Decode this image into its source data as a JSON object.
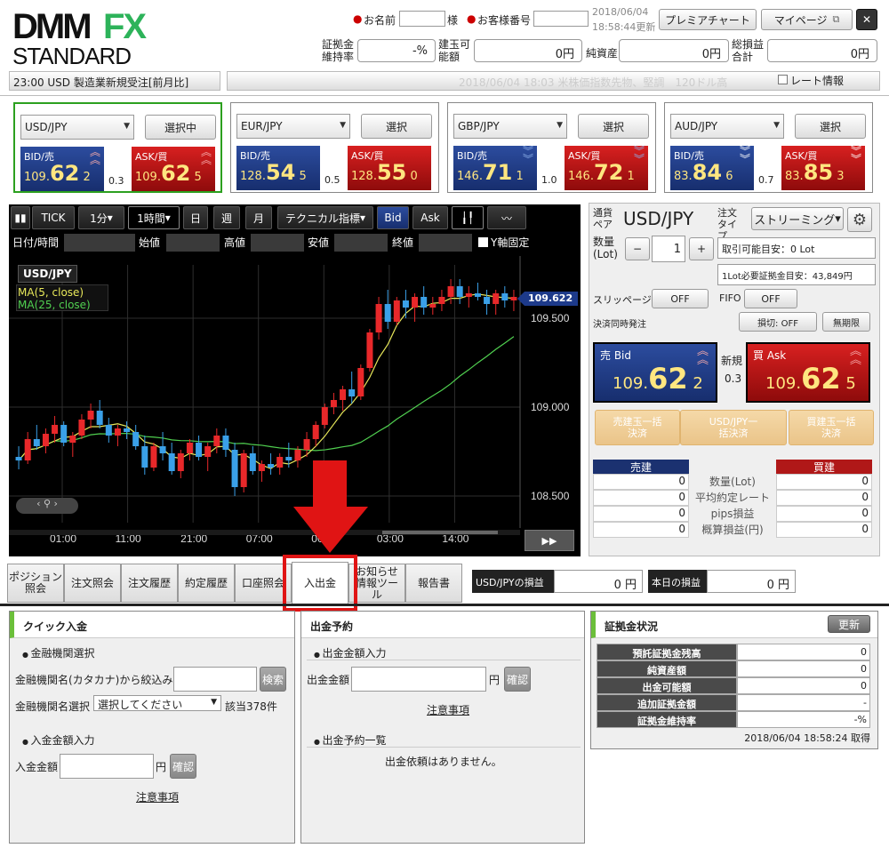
{
  "header": {
    "logo_main": "DMM",
    "logo_fx": "FX",
    "logo_sub": "STANDARD",
    "name_label": "お名前",
    "name_suffix": "様",
    "customer_no_label": "お客様番号",
    "datetime_date": "2018/06/04",
    "datetime_time": "18:58:44更新",
    "premier_chart": "プレミアチャート",
    "my_page": "マイページ",
    "close": "✕",
    "margin_ratio_label": "証拠金維持率",
    "margin_ratio": "-%",
    "position_capacity_label": "建玉可能額",
    "position_capacity": "0円",
    "net_assets_label": "純資産",
    "net_assets": "0円",
    "total_pl_label": "総損益合計",
    "total_pl": "0円"
  },
  "news": {
    "left": "23:00 USD 製造業新規受注[前月比]",
    "right": "2018/06/04 18:03 米株価指数先物、堅調　120ドル高",
    "rate_info": "レート情報"
  },
  "currencies": [
    {
      "pair": "USD/JPY",
      "btn": "選択中",
      "bid_label": "BID/売",
      "ask_label": "ASK/買",
      "bid_pre": "109.",
      "bid_big": "62",
      "bid_small": "2",
      "ask_pre": "109.",
      "ask_big": "62",
      "ask_small": "5",
      "spread": "0.3",
      "dir": "up"
    },
    {
      "pair": "EUR/JPY",
      "btn": "選択",
      "bid_label": "BID/売",
      "ask_label": "ASK/買",
      "bid_pre": "128.",
      "bid_big": "54",
      "bid_small": "5",
      "ask_pre": "128.",
      "ask_big": "55",
      "ask_small": "0",
      "spread": "0.5",
      "dir": "none"
    },
    {
      "pair": "GBP/JPY",
      "btn": "選択",
      "bid_label": "BID/売",
      "ask_label": "ASK/買",
      "bid_pre": "146.",
      "bid_big": "71",
      "bid_small": "1",
      "ask_pre": "146.",
      "ask_big": "72",
      "ask_small": "1",
      "spread": "1.0",
      "dir": "down"
    },
    {
      "pair": "AUD/JPY",
      "btn": "選択",
      "bid_label": "BID/売",
      "ask_label": "ASK/買",
      "bid_pre": "83.",
      "bid_big": "84",
      "bid_small": "6",
      "ask_pre": "83.",
      "ask_big": "85",
      "ask_small": "3",
      "spread": "0.7",
      "dir": "down"
    }
  ],
  "chart": {
    "tick": "TICK",
    "interval": "1分",
    "timeframe": "1時間",
    "day": "日",
    "week": "週",
    "month": "月",
    "indicator": "テクニカル指標",
    "bid": "Bid",
    "ask": "Ask",
    "date_label": "日付/時間",
    "open_label": "始値",
    "high_label": "高値",
    "low_label": "安値",
    "close_label": "終値",
    "yfix": "Y軸固定",
    "symbol": "USD/JPY",
    "ma5": "MA(5, close)",
    "ma25": "MA(25, close)",
    "current_price": "109.622",
    "yticks": [
      "109.500",
      "109.000",
      "108.500"
    ],
    "xticks": [
      "01:00",
      "11:00",
      "21:00",
      "07:00",
      "00",
      "03:00",
      "14:00"
    ],
    "fwd": "▶▶"
  },
  "order": {
    "pair_label": "通貨ペア",
    "pair": "USD/JPY",
    "type_label": "注文タイプ",
    "type": "ストリーミング",
    "qty_label": "数量(Lot)",
    "qty": "1",
    "minus": "−",
    "plus": "+",
    "tradable": "取引可能目安：0 Lot",
    "required_margin": "1Lot必要証拠金目安：43,849円",
    "slippage_label": "スリッページ",
    "slippage": "OFF",
    "fifo_label": "FIFO",
    "fifo": "OFF",
    "settle_label": "決済同時発注",
    "stoploss": "損切: OFF",
    "unlimited": "無期限",
    "sell_label": "売 Bid",
    "sell_pre": "109.",
    "sell_big": "62",
    "sell_small": "2",
    "buy_label": "買 Ask",
    "buy_pre": "109.",
    "buy_big": "62",
    "buy_small": "5",
    "new_label": "新規",
    "spread": "0.3",
    "bulk_sell": "売建玉一括決済",
    "bulk_pair": "USD/JPY一括決済",
    "bulk_buy": "買建玉一括決済",
    "sell_head": "売建",
    "buy_head": "買建",
    "rows": [
      {
        "label": "数量(Lot)",
        "sell": "0",
        "buy": "0"
      },
      {
        "label": "平均約定レート",
        "sell": "0",
        "buy": "0"
      },
      {
        "label": "pips損益",
        "sell": "0",
        "buy": "0"
      },
      {
        "label": "概算損益(円)",
        "sell": "0",
        "buy": "0"
      }
    ]
  },
  "tabs": [
    "ポジション照会",
    "注文照会",
    "注文履歴",
    "約定履歴",
    "口座照会",
    "入出金",
    "お知らせ情報ツール",
    "報告書"
  ],
  "pl": {
    "pair_label": "USD/JPYの損益",
    "pair_value": "0 円",
    "today_label": "本日の損益",
    "today_value": "0 円"
  },
  "quick": {
    "title": "クイック入金",
    "bank_sec": "金融機関選択",
    "kana_label": "金融機関名(カタカナ)から絞込み",
    "search": "検索",
    "bank_label": "金融機関名選択",
    "bank_select": "選択してください",
    "count": "該当378件",
    "amount_sec": "入金金額入力",
    "amount_label": "入金金額",
    "yen": "円",
    "confirm": "確認",
    "notice": "注意事項"
  },
  "withdraw": {
    "title": "出金予約",
    "amount_sec": "出金金額入力",
    "amount_label": "出金金額",
    "yen": "円",
    "confirm": "確認",
    "notice": "注意事項",
    "list_sec": "出金予約一覧",
    "empty": "出金依頼はありません。"
  },
  "margin": {
    "title": "証拠金状況",
    "refresh": "更新",
    "rows": [
      {
        "label": "預託証拠金残高",
        "value": "0"
      },
      {
        "label": "純資産額",
        "value": "0"
      },
      {
        "label": "出金可能額",
        "value": "0"
      },
      {
        "label": "追加証拠金額",
        "value": "-"
      },
      {
        "label": "証拠金維持率",
        "value": "-%"
      }
    ],
    "timestamp": "2018/06/04 18:58:24 取得"
  },
  "candles": [
    [
      108.72,
      108.78,
      108.65,
      108.7
    ],
    [
      108.7,
      108.86,
      108.68,
      108.82
    ],
    [
      108.82,
      108.9,
      108.76,
      108.78
    ],
    [
      108.78,
      108.88,
      108.74,
      108.85
    ],
    [
      108.85,
      108.95,
      108.8,
      108.9
    ],
    [
      108.9,
      108.92,
      108.78,
      108.8
    ],
    [
      108.8,
      108.86,
      108.72,
      108.84
    ],
    [
      108.84,
      108.96,
      108.82,
      108.93
    ],
    [
      108.93,
      109.02,
      108.88,
      108.98
    ],
    [
      108.98,
      109.04,
      108.88,
      108.9
    ],
    [
      108.9,
      108.94,
      108.8,
      108.84
    ],
    [
      108.84,
      108.9,
      108.78,
      108.88
    ],
    [
      108.88,
      108.92,
      108.82,
      108.86
    ],
    [
      108.86,
      108.9,
      108.76,
      108.78
    ],
    [
      108.78,
      108.84,
      108.62,
      108.66
    ],
    [
      108.66,
      108.8,
      108.64,
      108.78
    ],
    [
      108.78,
      108.86,
      108.7,
      108.74
    ],
    [
      108.74,
      108.8,
      108.62,
      108.64
    ],
    [
      108.64,
      108.76,
      108.6,
      108.74
    ],
    [
      108.74,
      108.82,
      108.7,
      108.8
    ],
    [
      108.8,
      108.84,
      108.7,
      108.72
    ],
    [
      108.72,
      108.8,
      108.64,
      108.78
    ],
    [
      108.78,
      108.88,
      108.74,
      108.84
    ],
    [
      108.84,
      108.88,
      108.72,
      108.76
    ],
    [
      108.76,
      108.8,
      108.5,
      108.55
    ],
    [
      108.55,
      108.76,
      108.52,
      108.74
    ],
    [
      108.74,
      108.78,
      108.62,
      108.64
    ],
    [
      108.64,
      108.7,
      108.58,
      108.68
    ],
    [
      108.68,
      108.74,
      108.62,
      108.66
    ],
    [
      108.66,
      108.74,
      108.62,
      108.72
    ],
    [
      108.72,
      108.8,
      108.66,
      108.7
    ],
    [
      108.7,
      108.78,
      108.66,
      108.76
    ],
    [
      108.76,
      108.86,
      108.72,
      108.82
    ],
    [
      108.82,
      108.92,
      108.78,
      108.9
    ],
    [
      108.9,
      109.02,
      108.88,
      109.0
    ],
    [
      109.0,
      109.08,
      108.96,
      109.04
    ],
    [
      109.04,
      109.12,
      108.98,
      109.1
    ],
    [
      109.1,
      109.2,
      109.02,
      109.06
    ],
    [
      109.06,
      109.24,
      109.04,
      109.22
    ],
    [
      109.22,
      109.44,
      109.2,
      109.42
    ],
    [
      109.42,
      109.62,
      109.38,
      109.58
    ],
    [
      109.58,
      109.66,
      109.44,
      109.48
    ],
    [
      109.48,
      109.62,
      109.46,
      109.6
    ],
    [
      109.6,
      109.66,
      109.5,
      109.56
    ],
    [
      109.56,
      109.64,
      109.48,
      109.62
    ],
    [
      109.62,
      109.68,
      109.52,
      109.56
    ],
    [
      109.56,
      109.62,
      109.52,
      109.58
    ],
    [
      109.58,
      109.66,
      109.54,
      109.62
    ],
    [
      109.62,
      109.72,
      109.58,
      109.68
    ],
    [
      109.68,
      109.72,
      109.58,
      109.62
    ],
    [
      109.62,
      109.68,
      109.56,
      109.64
    ],
    [
      109.64,
      109.7,
      109.6,
      109.62
    ],
    [
      109.62,
      109.66,
      109.52,
      109.58
    ],
    [
      109.58,
      109.66,
      109.52,
      109.64
    ],
    [
      109.64,
      109.68,
      109.56,
      109.6
    ],
    [
      109.6,
      109.66,
      109.54,
      109.62
    ]
  ]
}
